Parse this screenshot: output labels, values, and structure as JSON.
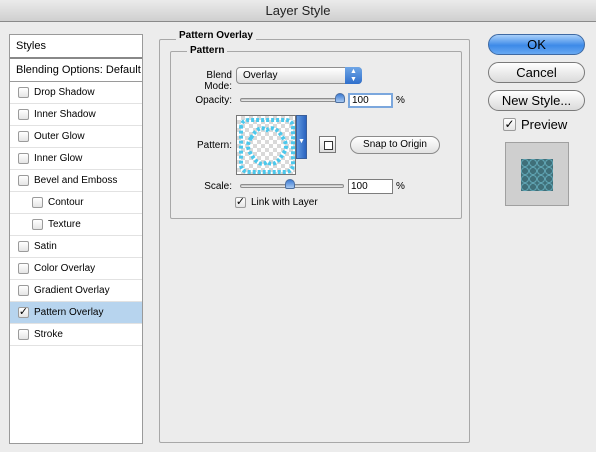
{
  "window": {
    "title": "Layer Style"
  },
  "sidebar": {
    "styles_label": "Styles",
    "blending_label": "Blending Options: Default",
    "items": [
      {
        "label": "Drop Shadow",
        "checked": false
      },
      {
        "label": "Inner Shadow",
        "checked": false
      },
      {
        "label": "Outer Glow",
        "checked": false
      },
      {
        "label": "Inner Glow",
        "checked": false
      },
      {
        "label": "Bevel and Emboss",
        "checked": false
      },
      {
        "label": "Contour",
        "checked": false
      },
      {
        "label": "Texture",
        "checked": false
      },
      {
        "label": "Satin",
        "checked": false
      },
      {
        "label": "Color Overlay",
        "checked": false
      },
      {
        "label": "Gradient Overlay",
        "checked": false
      },
      {
        "label": "Pattern Overlay",
        "checked": true
      },
      {
        "label": "Stroke",
        "checked": false
      }
    ]
  },
  "panel": {
    "title": "Pattern Overlay",
    "group_title": "Pattern",
    "blend_mode_label": "Blend Mode:",
    "blend_mode_value": "Overlay",
    "opacity_label": "Opacity:",
    "opacity_value": "100",
    "opacity_unit": "%",
    "pattern_label": "Pattern:",
    "snap_button": "Snap to Origin",
    "scale_label": "Scale:",
    "scale_value": "100",
    "scale_unit": "%",
    "link_label": "Link with Layer",
    "link_checked": true
  },
  "buttons": {
    "ok": "OK",
    "cancel": "Cancel",
    "new_style": "New Style...",
    "preview_label": "Preview",
    "preview_checked": true
  },
  "colors": {
    "accent": "#3d8ae8",
    "pattern": "#4cc8ec",
    "selection": "#b7d4ee"
  }
}
